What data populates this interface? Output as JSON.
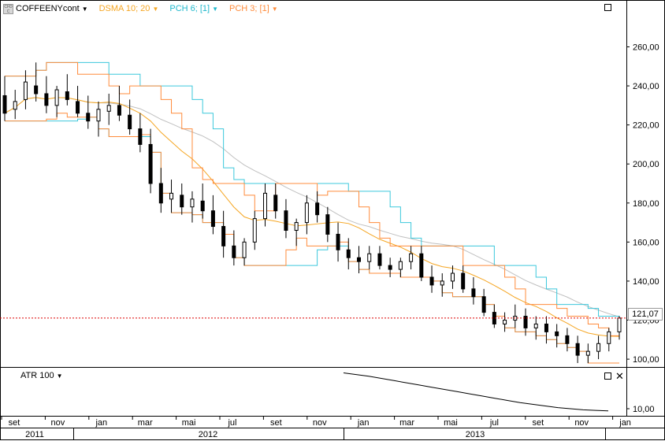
{
  "legend": {
    "symbol_icon_text": "CFD C",
    "symbol": "COFFEENYcont",
    "dsma": "DSMA 10; 20",
    "pch6": "PCH 6; [1]",
    "pch3": "PCH 3; [1]"
  },
  "atr_label": "ATR 100",
  "last_price_label": "121,07",
  "colors": {
    "dsma": "#f5a623",
    "pch6": "#3cc8dc",
    "pch3": "#ff8c3c",
    "gray_ma": "#c0c0c0",
    "price_line": "#dd0000",
    "candle": "#000000"
  },
  "chart_data": {
    "type": "candlestick",
    "price_axis": {
      "ylim": [
        96,
        284
      ],
      "ticks": [
        "100,00",
        "120,00",
        "140,00",
        "160,00",
        "180,00",
        "200,00",
        "220,00",
        "240,00",
        "260,00"
      ]
    },
    "atr_axis": {
      "ticks": [
        "10,00"
      ]
    },
    "x_axis": {
      "months": [
        "set",
        "nov",
        "jan",
        "mar",
        "mai",
        "jul",
        "set",
        "nov",
        "jan",
        "mar",
        "mai",
        "jul",
        "set",
        "nov",
        "jan"
      ],
      "years": [
        "2011",
        "2012",
        "2013"
      ]
    },
    "last_price": 121.07,
    "candles": [
      [
        235,
        245,
        222,
        226
      ],
      [
        228,
        238,
        223,
        232
      ],
      [
        233,
        248,
        228,
        242
      ],
      [
        240,
        252,
        232,
        236
      ],
      [
        236,
        245,
        226,
        230
      ],
      [
        230,
        240,
        224,
        238
      ],
      [
        237,
        246,
        230,
        233
      ],
      [
        232,
        240,
        224,
        226
      ],
      [
        226,
        235,
        218,
        222
      ],
      [
        222,
        232,
        214,
        228
      ],
      [
        227,
        236,
        220,
        230
      ],
      [
        230,
        240,
        222,
        225
      ],
      [
        225,
        233,
        215,
        218
      ],
      [
        218,
        226,
        206,
        210
      ],
      [
        210,
        218,
        185,
        190
      ],
      [
        190,
        198,
        175,
        180
      ],
      [
        182,
        192,
        175,
        185
      ],
      [
        184,
        190,
        174,
        178
      ],
      [
        178,
        186,
        170,
        182
      ],
      [
        181,
        190,
        172,
        176
      ],
      [
        176,
        184,
        164,
        168
      ],
      [
        168,
        176,
        152,
        158
      ],
      [
        158,
        166,
        148,
        152
      ],
      [
        152,
        162,
        148,
        160
      ],
      [
        160,
        176,
        156,
        172
      ],
      [
        172,
        190,
        168,
        185
      ],
      [
        184,
        190,
        172,
        176
      ],
      [
        176,
        182,
        162,
        166
      ],
      [
        166,
        172,
        158,
        170
      ],
      [
        170,
        184,
        164,
        180
      ],
      [
        180,
        186,
        170,
        174
      ],
      [
        174,
        178,
        160,
        164
      ],
      [
        164,
        170,
        150,
        156
      ],
      [
        156,
        162,
        146,
        152
      ],
      [
        152,
        158,
        144,
        150
      ],
      [
        150,
        158,
        146,
        154
      ],
      [
        154,
        158,
        146,
        148
      ],
      [
        148,
        152,
        142,
        146
      ],
      [
        146,
        152,
        142,
        150
      ],
      [
        150,
        158,
        146,
        154
      ],
      [
        154,
        158,
        140,
        142
      ],
      [
        142,
        148,
        134,
        138
      ],
      [
        138,
        144,
        132,
        140
      ],
      [
        140,
        148,
        136,
        144
      ],
      [
        144,
        148,
        134,
        136
      ],
      [
        136,
        142,
        128,
        132
      ],
      [
        132,
        136,
        122,
        124
      ],
      [
        124,
        128,
        116,
        118
      ],
      [
        118,
        124,
        114,
        120
      ],
      [
        120,
        128,
        116,
        122
      ],
      [
        122,
        126,
        112,
        116
      ],
      [
        116,
        122,
        110,
        118
      ],
      [
        118,
        122,
        108,
        114
      ],
      [
        114,
        118,
        106,
        112
      ],
      [
        112,
        116,
        104,
        108
      ],
      [
        108,
        112,
        98,
        102
      ],
      [
        102,
        108,
        98,
        104
      ],
      [
        104,
        112,
        100,
        108
      ],
      [
        108,
        116,
        104,
        114
      ],
      [
        114,
        122,
        110,
        121.07
      ]
    ],
    "atr_values": [
      16.5,
      16.2,
      15.9,
      15.5,
      15.1,
      14.7,
      14.3,
      13.9,
      13.5,
      13.1,
      12.7,
      12.3,
      11.9,
      11.5,
      11.1,
      10.8,
      10.5,
      10.2,
      10.0,
      9.8,
      9.7,
      9.6
    ]
  }
}
